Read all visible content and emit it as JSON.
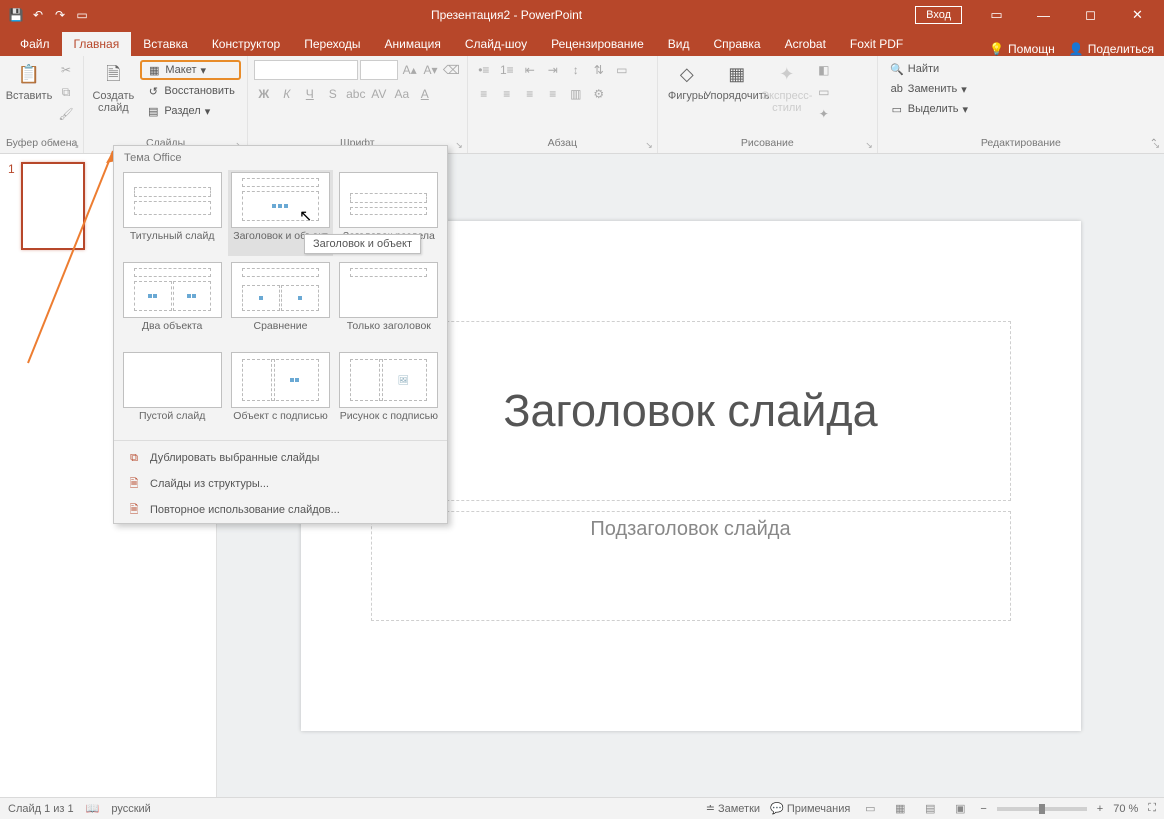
{
  "titlebar": {
    "title": "Презентация2 - PowerPoint",
    "sign_in": "Вход"
  },
  "tabs": {
    "file": "Файл",
    "home": "Главная",
    "insert": "Вставка",
    "design": "Конструктор",
    "transitions": "Переходы",
    "animations": "Анимация",
    "slideshow": "Слайд-шоу",
    "review": "Рецензирование",
    "view": "Вид",
    "help": "Справка",
    "acrobat": "Acrobat",
    "foxit": "Foxit PDF",
    "assist": "Помощн",
    "share": "Поделиться"
  },
  "ribbon": {
    "clipboard": {
      "label": "Буфер обмена",
      "paste": "Вставить"
    },
    "slides": {
      "label": "Слайды",
      "new_slide": "Создать\nслайд",
      "layout": "Макет",
      "reset": "Восстановить",
      "section": "Раздел"
    },
    "font": {
      "label": "Шрифт"
    },
    "paragraph": {
      "label": "Абзац"
    },
    "drawing": {
      "label": "Рисование",
      "shapes": "Фигуры",
      "arrange": "Упорядочить",
      "quick_styles": "Экспресс-\nстили"
    },
    "editing": {
      "label": "Редактирование",
      "find": "Найти",
      "replace": "Заменить",
      "select": "Выделить"
    }
  },
  "gallery": {
    "header": "Тема Office",
    "items": [
      "Титульный слайд",
      "Заголовок и объект",
      "Заголовок раздела",
      "Два объекта",
      "Сравнение",
      "Только заголовок",
      "Пустой слайд",
      "Объект с подписью",
      "Рисунок с подписью"
    ],
    "tooltip": "Заголовок и объект",
    "menu": {
      "duplicate": "Дублировать выбранные слайды",
      "outline": "Слайды из структуры...",
      "reuse": "Повторное использование слайдов..."
    }
  },
  "slide": {
    "number": "1",
    "title_placeholder": "Заголовок слайда",
    "subtitle_placeholder": "Подзаголовок слайда"
  },
  "status": {
    "slide_of": "Слайд 1 из 1",
    "language": "русский",
    "notes": "Заметки",
    "comments": "Примечания",
    "zoom": "70 %"
  }
}
